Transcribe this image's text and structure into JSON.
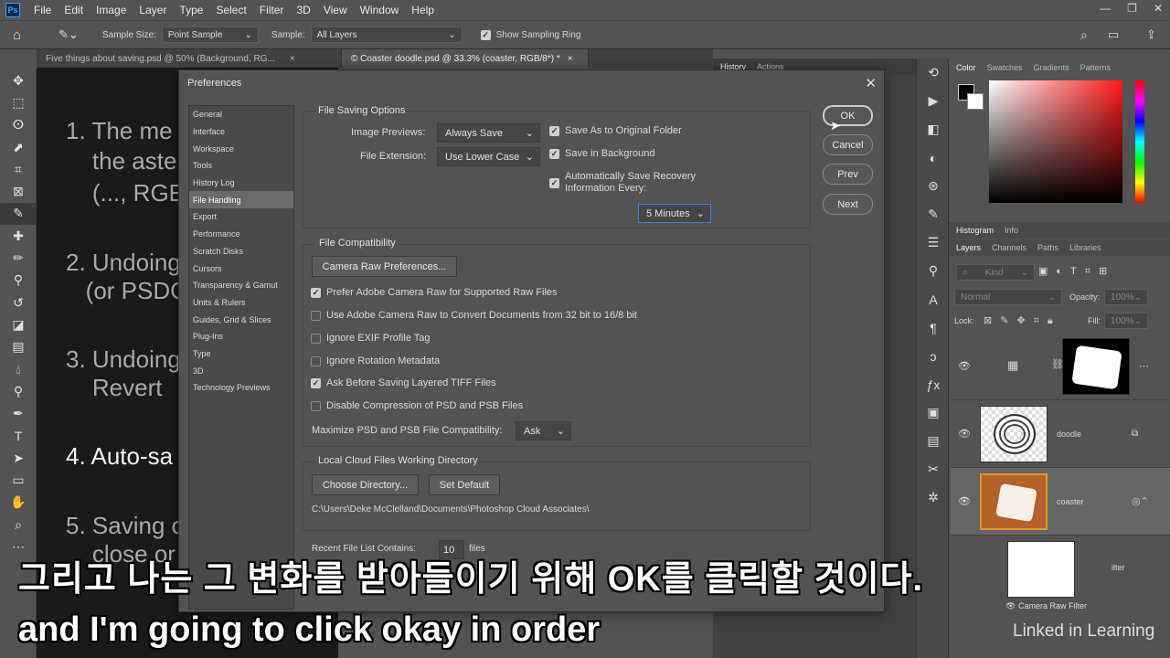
{
  "app": {
    "logo": "Ps",
    "menu": [
      "File",
      "Edit",
      "Image",
      "Layer",
      "Type",
      "Select",
      "Filter",
      "3D",
      "View",
      "Window",
      "Help"
    ],
    "window_controls": [
      "—",
      "❐",
      "✕"
    ]
  },
  "options": {
    "sample_size_label": "Sample Size:",
    "sample_size_value": "Point Sample",
    "sample_label": "Sample:",
    "sample_value": "All Layers",
    "show_ring_label": "Show Sampling Ring"
  },
  "doc_tabs": [
    {
      "label": "Five things about saving.psd @ 50% (Background, RG...",
      "close": "×"
    },
    {
      "label": "© Coaster doodle.psd @ 33.3% (coaster, RGB/8*) *",
      "close": "×"
    }
  ],
  "slide_lines": [
    "1. The me",
    "    the aste",
    "    (..., RGE",
    "2. Undoing",
    "   (or PSDC",
    "3. Undoing",
    "    Revert",
    "4. Auto-sa",
    "5. Saving c",
    "    close or"
  ],
  "mid_panel": {
    "tabs": [
      "History",
      "Actions"
    ]
  },
  "right_panel": {
    "color_tabs": [
      "Color",
      "Swatches",
      "Gradients",
      "Patterns"
    ],
    "hist_tabs": [
      "Histogram",
      "Info"
    ],
    "layer_tabs": [
      "Layers",
      "Channels",
      "Paths",
      "Libraries"
    ],
    "kind_label": "Kind",
    "blend_mode": "Normal",
    "opacity_label": "Opacity:",
    "opacity_value": "100%",
    "lock_label": "Lock:",
    "fill_label": "Fill:",
    "fill_value": "100%",
    "layers": [
      {
        "name": ""
      },
      {
        "name": "doodle"
      },
      {
        "name": "coaster"
      },
      {
        "name": "ilter"
      }
    ],
    "camera_raw_filter": "Camera Raw Filter",
    "colors": {
      "fg": "#000000",
      "bg": "#ffffff"
    }
  },
  "dialog": {
    "title": "Preferences",
    "close": "✕",
    "categories": [
      "General",
      "Interface",
      "Workspace",
      "Tools",
      "History Log",
      "File Handling",
      "Export",
      "Performance",
      "Scratch Disks",
      "Cursors",
      "Transparency & Gamut",
      "Units & Rulers",
      "Guides, Grid & Slices",
      "Plug-Ins",
      "Type",
      "3D",
      "Technology Previews"
    ],
    "selected_category": "File Handling",
    "buttons": {
      "ok": "OK",
      "cancel": "Cancel",
      "prev": "Prev",
      "next": "Next"
    },
    "file_saving": {
      "title": "File Saving Options",
      "image_previews_label": "Image Previews:",
      "image_previews_value": "Always Save",
      "file_extension_label": "File Extension:",
      "file_extension_value": "Use Lower Case",
      "save_as_original": "Save As to Original Folder",
      "save_in_background": "Save in Background",
      "auto_save_line1": "Automatically Save Recovery",
      "auto_save_line2": "Information Every:",
      "auto_save_interval": "5 Minutes"
    },
    "compat": {
      "title": "File Compatibility",
      "camera_raw_button": "Camera Raw Preferences...",
      "options": [
        {
          "label": "Prefer Adobe Camera Raw for Supported Raw Files",
          "checked": true
        },
        {
          "label": "Use Adobe Camera Raw to Convert Documents from 32 bit to 16/8 bit",
          "checked": false
        },
        {
          "label": "Ignore EXIF Profile Tag",
          "checked": false
        },
        {
          "label": "Ignore Rotation Metadata",
          "checked": false
        },
        {
          "label": "Ask Before Saving Layered TIFF Files",
          "checked": true
        },
        {
          "label": "Disable Compression of PSD and PSB Files",
          "checked": false
        }
      ],
      "maximize_label": "Maximize PSD and PSB File Compatibility:",
      "maximize_value": "Ask"
    },
    "cloud": {
      "title": "Local Cloud Files Working Directory",
      "choose_button": "Choose Directory...",
      "default_button": "Set Default",
      "path": "C:\\Users\\Deke McClelland\\Documents\\Photoshop Cloud Associates\\"
    },
    "recent": {
      "label": "Recent File List Contains:",
      "value": "10",
      "unit": "files"
    }
  },
  "captions": {
    "ko": "그리고 나는 그 변화를 받아들이기 위해 OK를 클릭할 것이다.",
    "en": "and I'm going to click okay in order"
  },
  "watermark": "Linked in Learning",
  "status": {
    "zoom": "33"
  }
}
